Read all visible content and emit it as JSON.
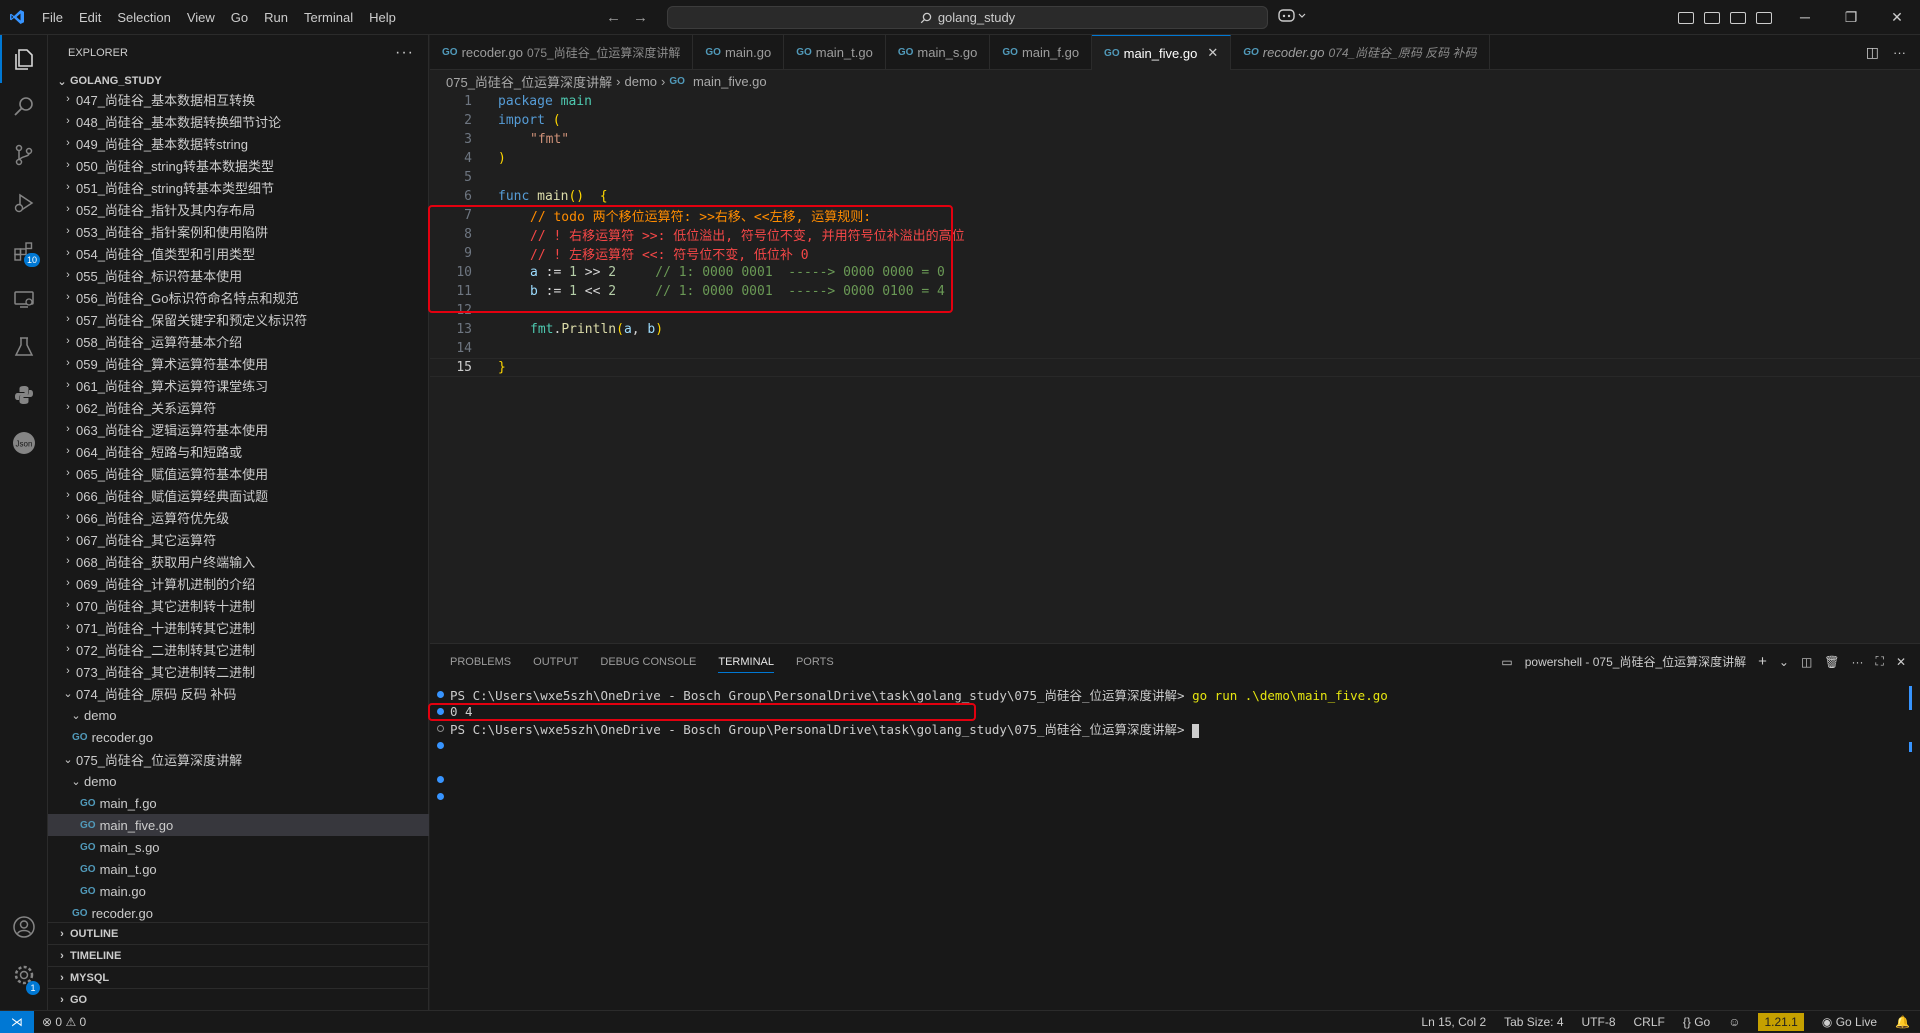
{
  "menu": [
    "File",
    "Edit",
    "Selection",
    "View",
    "Go",
    "Run",
    "Terminal",
    "Help"
  ],
  "search": {
    "text": "golang_study"
  },
  "sidebar": {
    "title": "EXPLORER",
    "root": "GOLANG_STUDY",
    "items": [
      {
        "label": "047_尚硅谷_基本数据相互转换",
        "depth": 0,
        "kind": "folder-closed"
      },
      {
        "label": "048_尚硅谷_基本数据转换细节讨论",
        "depth": 0,
        "kind": "folder-closed"
      },
      {
        "label": "049_尚硅谷_基本数据转string",
        "depth": 0,
        "kind": "folder-closed"
      },
      {
        "label": "050_尚硅谷_string转基本数据类型",
        "depth": 0,
        "kind": "folder-closed"
      },
      {
        "label": "051_尚硅谷_string转基本类型细节",
        "depth": 0,
        "kind": "folder-closed"
      },
      {
        "label": "052_尚硅谷_指针及其内存布局",
        "depth": 0,
        "kind": "folder-closed"
      },
      {
        "label": "053_尚硅谷_指针案例和使用陷阱",
        "depth": 0,
        "kind": "folder-closed"
      },
      {
        "label": "054_尚硅谷_值类型和引用类型",
        "depth": 0,
        "kind": "folder-closed"
      },
      {
        "label": "055_尚硅谷_标识符基本使用",
        "depth": 0,
        "kind": "folder-closed"
      },
      {
        "label": "056_尚硅谷_Go标识符命名特点和规范",
        "depth": 0,
        "kind": "folder-closed"
      },
      {
        "label": "057_尚硅谷_保留关键字和预定义标识符",
        "depth": 0,
        "kind": "folder-closed"
      },
      {
        "label": "058_尚硅谷_运算符基本介绍",
        "depth": 0,
        "kind": "folder-closed"
      },
      {
        "label": "059_尚硅谷_算术运算符基本使用",
        "depth": 0,
        "kind": "folder-closed"
      },
      {
        "label": "061_尚硅谷_算术运算符课堂练习",
        "depth": 0,
        "kind": "folder-closed"
      },
      {
        "label": "062_尚硅谷_关系运算符",
        "depth": 0,
        "kind": "folder-closed"
      },
      {
        "label": "063_尚硅谷_逻辑运算符基本使用",
        "depth": 0,
        "kind": "folder-closed"
      },
      {
        "label": "064_尚硅谷_短路与和短路或",
        "depth": 0,
        "kind": "folder-closed"
      },
      {
        "label": "065_尚硅谷_赋值运算符基本使用",
        "depth": 0,
        "kind": "folder-closed"
      },
      {
        "label": "066_尚硅谷_赋值运算经典面试题",
        "depth": 0,
        "kind": "folder-closed"
      },
      {
        "label": "066_尚硅谷_运算符优先级",
        "depth": 0,
        "kind": "folder-closed"
      },
      {
        "label": "067_尚硅谷_其它运算符",
        "depth": 0,
        "kind": "folder-closed"
      },
      {
        "label": "068_尚硅谷_获取用户终端输入",
        "depth": 0,
        "kind": "folder-closed"
      },
      {
        "label": "069_尚硅谷_计算机进制的介绍",
        "depth": 0,
        "kind": "folder-closed"
      },
      {
        "label": "070_尚硅谷_其它进制转十进制",
        "depth": 0,
        "kind": "folder-closed"
      },
      {
        "label": "071_尚硅谷_十进制转其它进制",
        "depth": 0,
        "kind": "folder-closed"
      },
      {
        "label": "072_尚硅谷_二进制转其它进制",
        "depth": 0,
        "kind": "folder-closed"
      },
      {
        "label": "073_尚硅谷_其它进制转二进制",
        "depth": 0,
        "kind": "folder-closed"
      },
      {
        "label": "074_尚硅谷_原码 反码 补码",
        "depth": 0,
        "kind": "folder-open"
      },
      {
        "label": "demo",
        "depth": 1,
        "kind": "folder-open"
      },
      {
        "label": "recoder.go",
        "depth": 1,
        "kind": "file"
      },
      {
        "label": "075_尚硅谷_位运算深度讲解",
        "depth": 0,
        "kind": "folder-open"
      },
      {
        "label": "demo",
        "depth": 1,
        "kind": "folder-open"
      },
      {
        "label": "main_f.go",
        "depth": 2,
        "kind": "file"
      },
      {
        "label": "main_five.go",
        "depth": 2,
        "kind": "file",
        "selected": true
      },
      {
        "label": "main_s.go",
        "depth": 2,
        "kind": "file"
      },
      {
        "label": "main_t.go",
        "depth": 2,
        "kind": "file"
      },
      {
        "label": "main.go",
        "depth": 2,
        "kind": "file"
      },
      {
        "label": "recoder.go",
        "depth": 1,
        "kind": "file"
      }
    ],
    "sections": [
      "OUTLINE",
      "TIMELINE",
      "MYSQL",
      "GO"
    ]
  },
  "activity": {
    "extensions_badge": "10",
    "settings_badge": "1"
  },
  "tabs": [
    {
      "name": "recoder.go",
      "desc": "075_尚硅谷_位运算深度讲解",
      "active": false,
      "italic": false
    },
    {
      "name": "main.go",
      "desc": "",
      "active": false,
      "italic": false
    },
    {
      "name": "main_t.go",
      "desc": "",
      "active": false,
      "italic": false
    },
    {
      "name": "main_s.go",
      "desc": "",
      "active": false,
      "italic": false
    },
    {
      "name": "main_f.go",
      "desc": "",
      "active": false,
      "italic": false
    },
    {
      "name": "main_five.go",
      "desc": "",
      "active": true,
      "italic": false
    },
    {
      "name": "recoder.go",
      "desc": "074_尚硅谷_原码 反码 补码",
      "active": false,
      "italic": true
    }
  ],
  "breadcrumb": [
    "075_尚硅谷_位运算深度讲解",
    "demo",
    "main_five.go"
  ],
  "code": {
    "line_numbers": [
      "1",
      "2",
      "3",
      "4",
      "5",
      "6",
      "7",
      "8",
      "9",
      "10",
      "11",
      "12",
      "13",
      "14",
      "15"
    ],
    "current_line": "15",
    "l1": [
      "package",
      " main"
    ],
    "l2": [
      "import",
      " ("
    ],
    "l3": "\"fmt\"",
    "l4": ")",
    "l6": [
      "func",
      " main",
      "()",
      "  {"
    ],
    "l7": "// todo 两个移位运算符: >>右移、<<左移, 运算规则:",
    "l8": "// ! 右移运算符 >>: 低位溢出, 符号位不变, 并用符号位补溢出的高位",
    "l9": "// ! 左移运算符 <<: 符号位不变, 低位补 0",
    "l10": [
      "a",
      " := ",
      "1",
      " >> ",
      "2",
      "     // 1: 0000 0001  -----> 0000 0000 = 0"
    ],
    "l11": [
      "b",
      " := ",
      "1",
      " << ",
      "2",
      "     // 1: 0000 0001  -----> 0000 0100 = 4"
    ],
    "l13": [
      "fmt",
      ".",
      "Println",
      "(",
      "a",
      ", ",
      "b",
      ")"
    ],
    "l15": "}"
  },
  "panel": {
    "tabs": [
      "PROBLEMS",
      "OUTPUT",
      "DEBUG CONSOLE",
      "TERMINAL",
      "PORTS"
    ],
    "active_tab": "TERMINAL",
    "terminal_name": "powershell - 075_尚硅谷_位运算深度讲解",
    "prompt1": "PS C:\\Users\\wxe5szh\\OneDrive - Bosch Group\\PersonalDrive\\task\\golang_study\\075_尚硅谷_位运算深度讲解>",
    "command": " go run .\\demo\\main_five.go",
    "output": "0 4",
    "prompt2": "PS C:\\Users\\wxe5szh\\OneDrive - Bosch Group\\PersonalDrive\\task\\golang_study\\075_尚硅谷_位运算深度讲解> "
  },
  "status": {
    "errors": "0",
    "warnings": "0",
    "position": "Ln 15, Col 2",
    "tab_size": "Tab Size: 4",
    "encoding": "UTF-8",
    "eol": "CRLF",
    "language": "Go",
    "go_version": "1.21.1",
    "live": "Go Live"
  },
  "colors": {
    "accent": "#0078d4",
    "highlight_box": "#e3000f",
    "status_version_bg": "#c5a000"
  }
}
